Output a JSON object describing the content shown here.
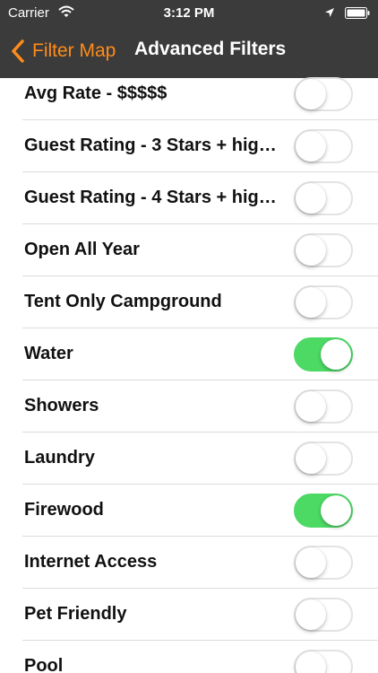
{
  "status_bar": {
    "carrier": "Carrier",
    "time": "3:12 PM"
  },
  "nav": {
    "back_label": "Filter Map",
    "title": "Advanced Filters"
  },
  "colors": {
    "nav_background": "#3b3b3b",
    "accent": "#ff8c1a",
    "toggle_on": "#4cd964"
  },
  "filters": [
    {
      "label": "Avg Rate - $$$$$",
      "on": false
    },
    {
      "label": "Guest Rating - 3 Stars + hig…",
      "on": false
    },
    {
      "label": "Guest Rating - 4 Stars + hig…",
      "on": false
    },
    {
      "label": "Open All Year",
      "on": false
    },
    {
      "label": "Tent Only Campground",
      "on": false
    },
    {
      "label": "Water",
      "on": true
    },
    {
      "label": "Showers",
      "on": false
    },
    {
      "label": "Laundry",
      "on": false
    },
    {
      "label": "Firewood",
      "on": true
    },
    {
      "label": "Internet Access",
      "on": false
    },
    {
      "label": "Pet Friendly",
      "on": false
    },
    {
      "label": "Pool",
      "on": false
    }
  ]
}
